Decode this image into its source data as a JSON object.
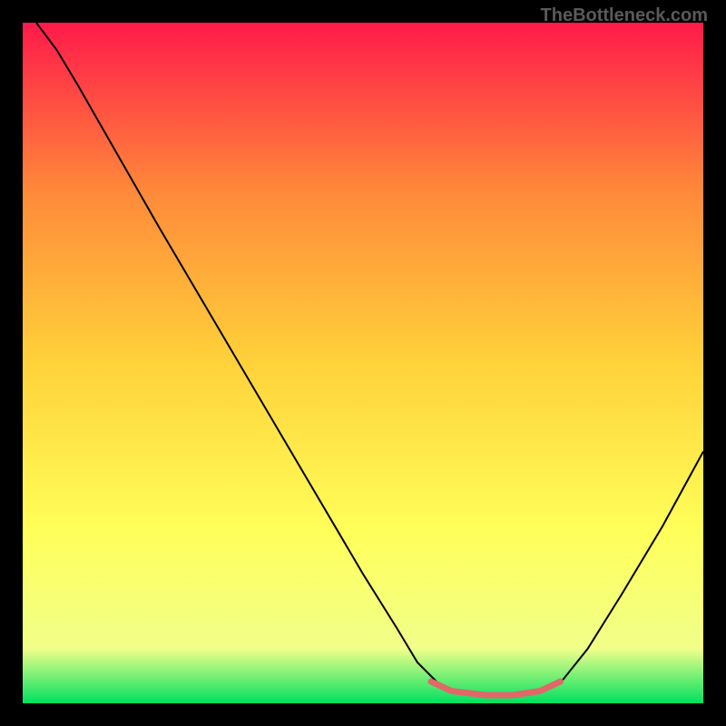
{
  "watermark": "TheBottleneck.com",
  "chart_data": {
    "type": "line",
    "title": "",
    "xlabel": "",
    "ylabel": "",
    "xlim": [
      0,
      100
    ],
    "ylim": [
      0,
      100
    ],
    "background_gradient": {
      "top": "#ff1a4a",
      "upper_mid": "#ff8a3a",
      "mid": "#ffd23a",
      "lower_mid": "#ffff5a",
      "near_bottom": "#f0ff8a",
      "bottom": "#00e060"
    },
    "series": [
      {
        "name": "curve",
        "color": "#000000",
        "stroke_width": 2,
        "points": [
          {
            "x": 2,
            "y": 100
          },
          {
            "x": 5,
            "y": 96
          },
          {
            "x": 8,
            "y": 91
          },
          {
            "x": 12,
            "y": 84
          },
          {
            "x": 20,
            "y": 70
          },
          {
            "x": 30,
            "y": 53
          },
          {
            "x": 40,
            "y": 36
          },
          {
            "x": 50,
            "y": 19
          },
          {
            "x": 55,
            "y": 11
          },
          {
            "x": 58,
            "y": 6
          },
          {
            "x": 61,
            "y": 3
          },
          {
            "x": 64,
            "y": 1.5
          },
          {
            "x": 68,
            "y": 1
          },
          {
            "x": 72,
            "y": 1
          },
          {
            "x": 76,
            "y": 1.5
          },
          {
            "x": 79,
            "y": 3
          },
          {
            "x": 83,
            "y": 8
          },
          {
            "x": 88,
            "y": 16
          },
          {
            "x": 94,
            "y": 26
          },
          {
            "x": 100,
            "y": 37
          }
        ]
      },
      {
        "name": "highlight",
        "color": "#e06868",
        "stroke_width": 7,
        "linecap": "round",
        "points": [
          {
            "x": 60,
            "y": 3.2
          },
          {
            "x": 63,
            "y": 1.8
          },
          {
            "x": 68,
            "y": 1.2
          },
          {
            "x": 72,
            "y": 1.2
          },
          {
            "x": 76,
            "y": 1.8
          },
          {
            "x": 79,
            "y": 3.2
          }
        ]
      }
    ]
  }
}
